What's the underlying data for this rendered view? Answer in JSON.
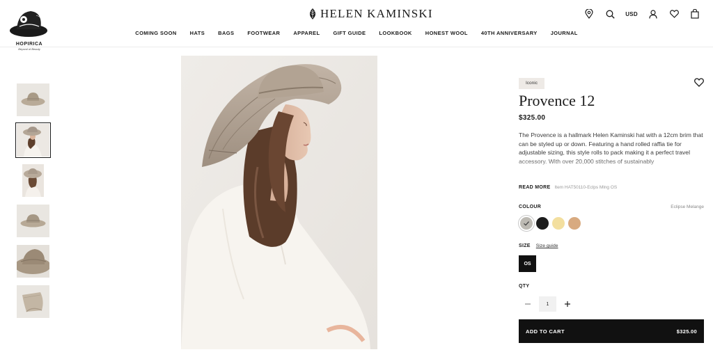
{
  "site": {
    "brand": "HELEN KAMINSKI",
    "badge_name": "HOPIRICA",
    "badge_tagline": "Beyond of Beauty"
  },
  "nav": {
    "items": [
      "COMING SOON",
      "HATS",
      "BAGS",
      "FOOTWEAR",
      "APPAREL",
      "GIFT GUIDE",
      "LOOKBOOK",
      "HONEST WOOL",
      "40TH ANNIVERSARY",
      "JOURNAL"
    ]
  },
  "header_icons": {
    "location": "map-pin-icon",
    "search": "search-icon",
    "currency": "USD",
    "account": "user-icon",
    "wishlist": "heart-icon",
    "bag": "shopping-bag-icon"
  },
  "gallery": {
    "thumbnail_count": 6,
    "active_index": 1
  },
  "product": {
    "tag": "Iconic",
    "title": "Provence 12",
    "price": "$325.00",
    "description": "The Provence is a hallmark Helen Kaminski hat with a 12cm brim that can be styled up or down. Featuring a hand rolled raffia tie for adjustable sizing, this style rolls to pack making it a perfect travel accessory. With over 20,000 stitches of sustainably",
    "read_more": "READ MORE",
    "item_code": "Item HAT50110-Eclps Mlng OS",
    "colour_label": "COLOUR",
    "colour_value": "Eclipse Melange",
    "swatches": [
      {
        "name": "eclipse-melange",
        "color": "#bdbab3",
        "selected": true
      },
      {
        "name": "black",
        "color": "#1c1c1c",
        "selected": false
      },
      {
        "name": "butter",
        "color": "#f3df9f",
        "selected": false
      },
      {
        "name": "tan",
        "color": "#d8aa80",
        "selected": false
      }
    ],
    "size_label": "SIZE",
    "size_guide": "Size guide",
    "size_option": "OS",
    "qty_label": "QTY",
    "qty_value": "1",
    "add_to_cart": "ADD TO CART",
    "cart_price": "$325.00"
  }
}
